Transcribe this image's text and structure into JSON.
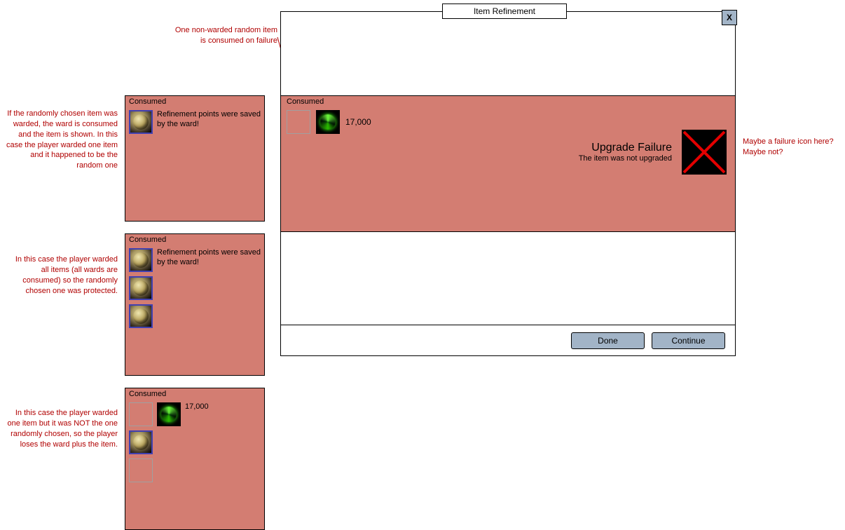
{
  "window": {
    "title": "Item Refinement",
    "close": "X",
    "consumed_header": "Consumed",
    "points_value": "17,000",
    "result_title": "Upgrade Failure",
    "result_sub": "The item was not upgraded",
    "done": "Done",
    "continue": "Continue"
  },
  "panels": {
    "header": "Consumed",
    "ward_saved_text": "Refinement points were saved by the ward!",
    "points_value": "17,000"
  },
  "annotations": {
    "a1": "If the randomly chosen item was warded, the ward is consumed and the item is shown. In this case the player warded one item and it happened to be the random one",
    "a2": "In this case the player warded all items (all wards are consumed) so the randomly chosen one was protected.",
    "a3": "In this case the player warded one item but it was NOT the one randomly chosen, so the player loses the ward plus the item.",
    "top": "One non-warded random item is consumed on failure",
    "right": "Maybe a failure icon here? Maybe not?"
  }
}
